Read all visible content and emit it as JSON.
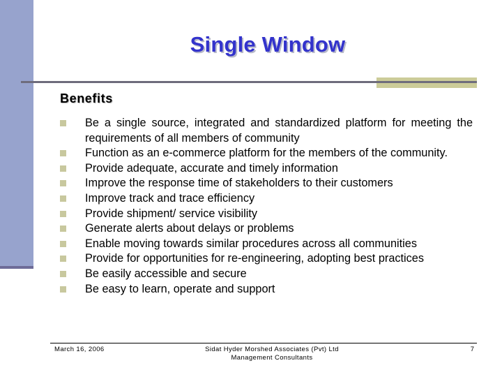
{
  "slide": {
    "title": "Single Window",
    "heading": "Benefits",
    "bullets": [
      "Be a single source, integrated and standardized platform for meeting the requirements of all members of community",
      "Function as an e-commerce platform for the members of the community.",
      "Provide adequate, accurate and timely information",
      "Improve the response time of stakeholders to their customers",
      "Improve track and trace efficiency",
      "Provide shipment/ service visibility",
      "Generate alerts about delays or problems",
      "Enable moving towards similar procedures across all communities",
      "Provide for opportunities for re-engineering, adopting best practices",
      "Be easily accessible and secure",
      "Be easy to learn, operate and support"
    ]
  },
  "footer": {
    "date": "March 16, 2006",
    "company_line1": "Sidat Hyder Morshed Associates (Pvt) Ltd",
    "company_line2": "Management Consultants",
    "page_number": "7"
  },
  "colors": {
    "title": "#3333cc",
    "left_bar": "#97a3cd",
    "accent_bar": "#cccc99",
    "bullet": "#c8c89e"
  }
}
